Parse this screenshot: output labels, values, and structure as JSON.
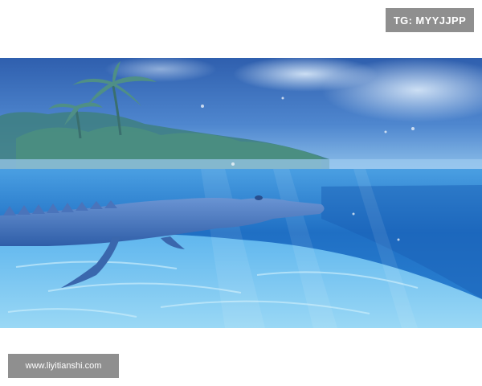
{
  "overlay": {
    "top_right_badge": "TG: MYYJJPP",
    "bottom_left_watermark": "www.liyitianshi.com"
  },
  "scene": {
    "subject": "crocodile-underwater",
    "colors": {
      "sky_top": "#2f5fae",
      "sky_bottom": "#8fc1ea",
      "water_deep": "#1f6fc4",
      "water_light": "#5fb6ee",
      "sand": "#8cd0f2",
      "crocodile": "#3e6fb8",
      "palm": "#3f7f84"
    }
  }
}
